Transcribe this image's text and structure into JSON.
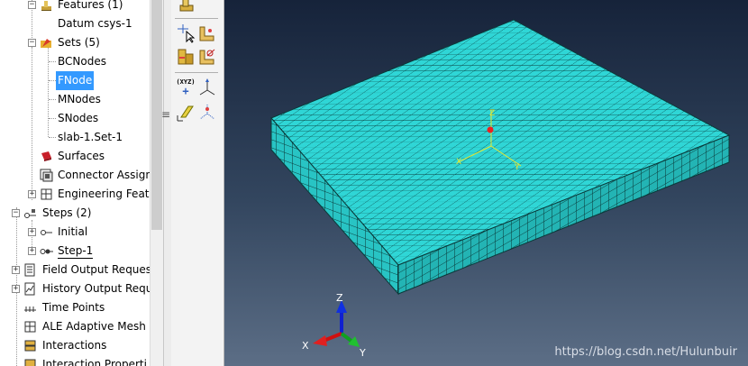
{
  "tree": {
    "items": [
      {
        "label": "Features (1)"
      },
      {
        "label": "Datum csys-1"
      },
      {
        "label": "Sets (5)"
      },
      {
        "label": "BCNodes"
      },
      {
        "label": "FNode"
      },
      {
        "label": "MNodes"
      },
      {
        "label": "SNodes"
      },
      {
        "label": "slab-1.Set-1"
      },
      {
        "label": "Surfaces"
      },
      {
        "label": "Connector Assign"
      },
      {
        "label": "Engineering Featu"
      },
      {
        "label": "Steps (2)"
      },
      {
        "label": "Initial"
      },
      {
        "label": "Step-1"
      },
      {
        "label": "Field Output Reques"
      },
      {
        "label": "History Output Requ"
      },
      {
        "label": "Time Points"
      },
      {
        "label": "ALE Adaptive Mesh C"
      },
      {
        "label": "Interactions"
      },
      {
        "label": "Interaction Properti"
      }
    ],
    "selected": "FNode"
  },
  "toolbox": {
    "csys_label": "(XYZ)"
  },
  "viewport": {
    "mesh_color": "#2fd6d6",
    "triad": {
      "x": "X",
      "y": "Y",
      "z": "Z"
    },
    "watermark": "https://blog.csdn.net/Hulunbuir"
  }
}
